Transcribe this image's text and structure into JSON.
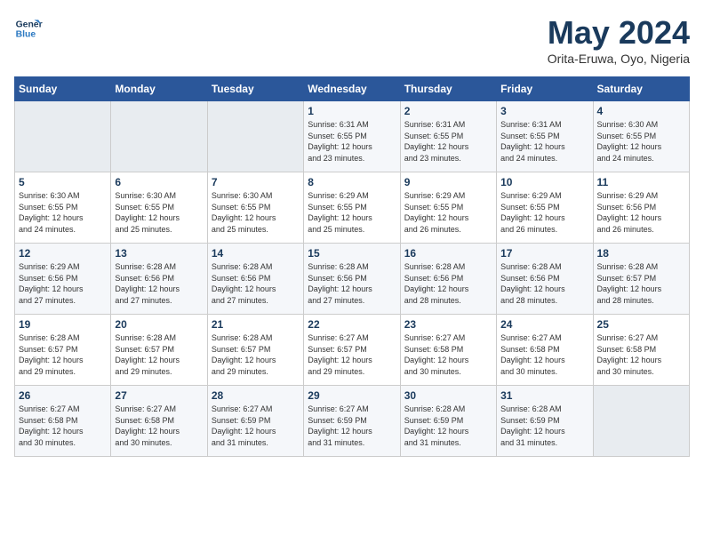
{
  "logo": {
    "line1": "General",
    "line2": "Blue"
  },
  "title": "May 2024",
  "subtitle": "Orita-Eruwa, Oyo, Nigeria",
  "header_days": [
    "Sunday",
    "Monday",
    "Tuesday",
    "Wednesday",
    "Thursday",
    "Friday",
    "Saturday"
  ],
  "weeks": [
    [
      {
        "day": "",
        "info": ""
      },
      {
        "day": "",
        "info": ""
      },
      {
        "day": "",
        "info": ""
      },
      {
        "day": "1",
        "info": "Sunrise: 6:31 AM\nSunset: 6:55 PM\nDaylight: 12 hours\nand 23 minutes."
      },
      {
        "day": "2",
        "info": "Sunrise: 6:31 AM\nSunset: 6:55 PM\nDaylight: 12 hours\nand 23 minutes."
      },
      {
        "day": "3",
        "info": "Sunrise: 6:31 AM\nSunset: 6:55 PM\nDaylight: 12 hours\nand 24 minutes."
      },
      {
        "day": "4",
        "info": "Sunrise: 6:30 AM\nSunset: 6:55 PM\nDaylight: 12 hours\nand 24 minutes."
      }
    ],
    [
      {
        "day": "5",
        "info": "Sunrise: 6:30 AM\nSunset: 6:55 PM\nDaylight: 12 hours\nand 24 minutes."
      },
      {
        "day": "6",
        "info": "Sunrise: 6:30 AM\nSunset: 6:55 PM\nDaylight: 12 hours\nand 25 minutes."
      },
      {
        "day": "7",
        "info": "Sunrise: 6:30 AM\nSunset: 6:55 PM\nDaylight: 12 hours\nand 25 minutes."
      },
      {
        "day": "8",
        "info": "Sunrise: 6:29 AM\nSunset: 6:55 PM\nDaylight: 12 hours\nand 25 minutes."
      },
      {
        "day": "9",
        "info": "Sunrise: 6:29 AM\nSunset: 6:55 PM\nDaylight: 12 hours\nand 26 minutes."
      },
      {
        "day": "10",
        "info": "Sunrise: 6:29 AM\nSunset: 6:55 PM\nDaylight: 12 hours\nand 26 minutes."
      },
      {
        "day": "11",
        "info": "Sunrise: 6:29 AM\nSunset: 6:56 PM\nDaylight: 12 hours\nand 26 minutes."
      }
    ],
    [
      {
        "day": "12",
        "info": "Sunrise: 6:29 AM\nSunset: 6:56 PM\nDaylight: 12 hours\nand 27 minutes."
      },
      {
        "day": "13",
        "info": "Sunrise: 6:28 AM\nSunset: 6:56 PM\nDaylight: 12 hours\nand 27 minutes."
      },
      {
        "day": "14",
        "info": "Sunrise: 6:28 AM\nSunset: 6:56 PM\nDaylight: 12 hours\nand 27 minutes."
      },
      {
        "day": "15",
        "info": "Sunrise: 6:28 AM\nSunset: 6:56 PM\nDaylight: 12 hours\nand 27 minutes."
      },
      {
        "day": "16",
        "info": "Sunrise: 6:28 AM\nSunset: 6:56 PM\nDaylight: 12 hours\nand 28 minutes."
      },
      {
        "day": "17",
        "info": "Sunrise: 6:28 AM\nSunset: 6:56 PM\nDaylight: 12 hours\nand 28 minutes."
      },
      {
        "day": "18",
        "info": "Sunrise: 6:28 AM\nSunset: 6:57 PM\nDaylight: 12 hours\nand 28 minutes."
      }
    ],
    [
      {
        "day": "19",
        "info": "Sunrise: 6:28 AM\nSunset: 6:57 PM\nDaylight: 12 hours\nand 29 minutes."
      },
      {
        "day": "20",
        "info": "Sunrise: 6:28 AM\nSunset: 6:57 PM\nDaylight: 12 hours\nand 29 minutes."
      },
      {
        "day": "21",
        "info": "Sunrise: 6:28 AM\nSunset: 6:57 PM\nDaylight: 12 hours\nand 29 minutes."
      },
      {
        "day": "22",
        "info": "Sunrise: 6:27 AM\nSunset: 6:57 PM\nDaylight: 12 hours\nand 29 minutes."
      },
      {
        "day": "23",
        "info": "Sunrise: 6:27 AM\nSunset: 6:58 PM\nDaylight: 12 hours\nand 30 minutes."
      },
      {
        "day": "24",
        "info": "Sunrise: 6:27 AM\nSunset: 6:58 PM\nDaylight: 12 hours\nand 30 minutes."
      },
      {
        "day": "25",
        "info": "Sunrise: 6:27 AM\nSunset: 6:58 PM\nDaylight: 12 hours\nand 30 minutes."
      }
    ],
    [
      {
        "day": "26",
        "info": "Sunrise: 6:27 AM\nSunset: 6:58 PM\nDaylight: 12 hours\nand 30 minutes."
      },
      {
        "day": "27",
        "info": "Sunrise: 6:27 AM\nSunset: 6:58 PM\nDaylight: 12 hours\nand 30 minutes."
      },
      {
        "day": "28",
        "info": "Sunrise: 6:27 AM\nSunset: 6:59 PM\nDaylight: 12 hours\nand 31 minutes."
      },
      {
        "day": "29",
        "info": "Sunrise: 6:27 AM\nSunset: 6:59 PM\nDaylight: 12 hours\nand 31 minutes."
      },
      {
        "day": "30",
        "info": "Sunrise: 6:28 AM\nSunset: 6:59 PM\nDaylight: 12 hours\nand 31 minutes."
      },
      {
        "day": "31",
        "info": "Sunrise: 6:28 AM\nSunset: 6:59 PM\nDaylight: 12 hours\nand 31 minutes."
      },
      {
        "day": "",
        "info": ""
      }
    ]
  ]
}
